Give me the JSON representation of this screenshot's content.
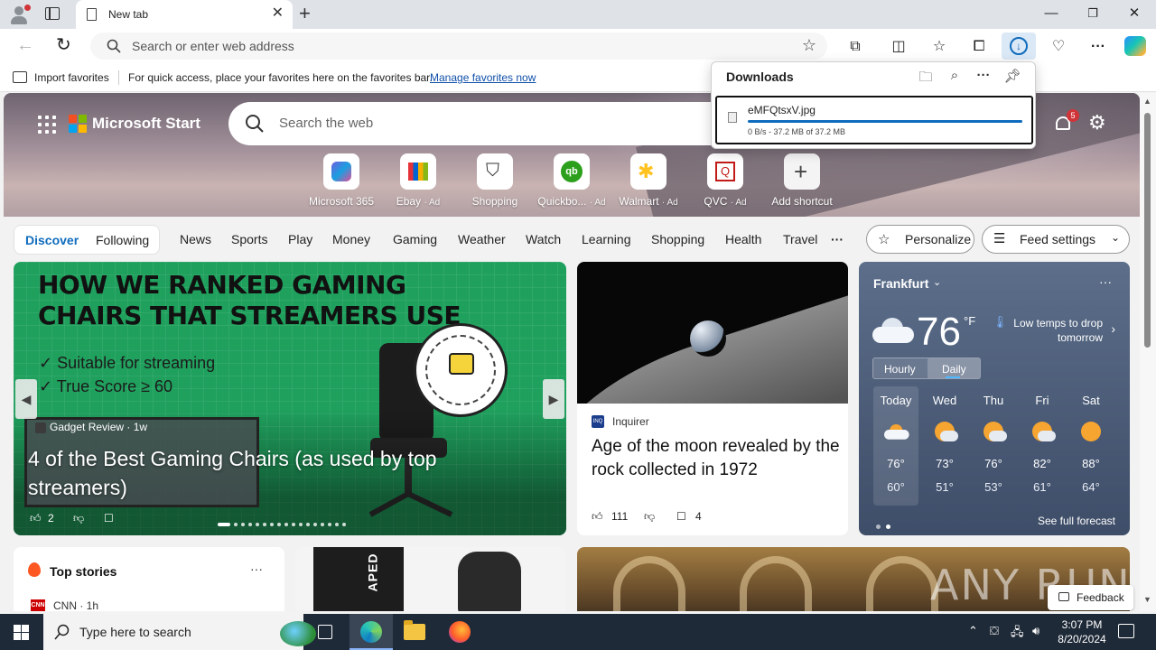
{
  "browser": {
    "tab_title": "New tab",
    "address_placeholder": "Search or enter web address",
    "favorites_bar": {
      "import_label": "Import favorites",
      "message": "For quick access, place your favorites here on the favorites bar.",
      "manage_link": "Manage favorites now"
    },
    "downloads": {
      "title": "Downloads",
      "file_name": "eMFQtsxV.jpg",
      "status": "0 B/s - 37.2 MB of 37.2 MB",
      "progress": 1.0
    }
  },
  "start_page": {
    "brand": "Microsoft Start",
    "search_placeholder": "Search the web",
    "notification_count": "5",
    "shortcuts": [
      {
        "label": "Microsoft 365",
        "ad": ""
      },
      {
        "label": "Ebay",
        "ad": "· Ad"
      },
      {
        "label": "Shopping",
        "ad": ""
      },
      {
        "label": "Quickbo...",
        "ad": "· Ad"
      },
      {
        "label": "Walmart",
        "ad": "· Ad"
      },
      {
        "label": "QVC",
        "ad": "· Ad"
      },
      {
        "label": "Add shortcut",
        "ad": ""
      }
    ],
    "feed_tabs": [
      "Discover",
      "Following"
    ],
    "categories": [
      "News",
      "Sports",
      "Play",
      "Money",
      "Gaming",
      "Weather",
      "Watch",
      "Learning",
      "Shopping",
      "Health",
      "Travel"
    ],
    "more_categories": "···",
    "personalize_label": "Personalize",
    "feed_settings_label": "Feed settings",
    "hero_card": {
      "image_headline": "HOW WE RANKED GAMING CHAIRS THAT STREAMERS USE",
      "image_points": [
        "✓ Suitable for streaming",
        "✓ True Score ≥ 60"
      ],
      "source": "Gadget Review · 1w",
      "title": "4 of the Best Gaming Chairs (as used by top streamers)",
      "likes": "2"
    },
    "moon_card": {
      "publisher_icon": "INQ",
      "publisher": "Inquirer",
      "title": "Age of the moon revealed by the rock collected in 1972",
      "likes": "111",
      "comments": "4"
    },
    "weather": {
      "city": "Frankfurt",
      "temperature": "76",
      "unit": "°F",
      "note": "Low temps to drop tomorrow",
      "toggle": [
        "Hourly",
        "Daily"
      ],
      "days": [
        {
          "name": "Today",
          "hi": "76°",
          "lo": "60°"
        },
        {
          "name": "Wed",
          "hi": "73°",
          "lo": "51°"
        },
        {
          "name": "Thu",
          "hi": "76°",
          "lo": "53°"
        },
        {
          "name": "Fri",
          "hi": "82°",
          "lo": "61°"
        },
        {
          "name": "Sat",
          "hi": "88°",
          "lo": "64°"
        }
      ],
      "see_forecast": "See full forecast"
    },
    "top_stories": {
      "title": "Top stories",
      "source_logo": "CNN",
      "source": "CNN · 1h"
    },
    "product_label": "APED",
    "watermark": "ANY RUN",
    "feedback_label": "Feedback"
  },
  "taskbar": {
    "search_placeholder": "Type here to search",
    "time": "3:07 PM",
    "date": "8/20/2024"
  },
  "colors": {
    "accent": "#0f6cbd",
    "hero_card_bg": "#1fa05d",
    "weather_bg": "#4d5d79",
    "taskbar": "#1f2a38"
  }
}
